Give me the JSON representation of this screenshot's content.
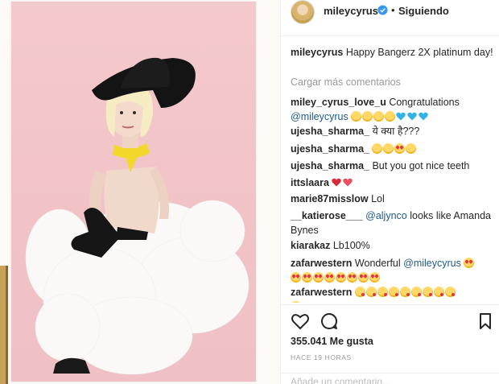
{
  "post": {
    "username": "mileycyrus",
    "follow_status": "Siguiendo",
    "dot": "•",
    "caption_user": "mileycyrus",
    "caption_text": "Happy Bangerz 2X platinum day!",
    "load_more": "Cargar más comentarios",
    "likes": "355.041 Me gusta",
    "time_ago": "HACE 19 HORAS",
    "add_comment_placeholder": "Añade un comentario..."
  },
  "comments": [
    {
      "user": "miley_cyrus_love_u",
      "text": "Congratulations",
      "mention": "@mileycyrus",
      "emoji": [
        "grin-icon",
        "grin-icon",
        "grin-icon",
        "grin-icon",
        "blue-heart-icon",
        "blue-heart-icon",
        "blue-heart-icon"
      ]
    },
    {
      "user": "ujesha_sharma_",
      "text": "ये क्या है???"
    },
    {
      "user": "ujesha_sharma_",
      "text": "",
      "emoji": [
        "laughing-icon",
        "grimace-icon",
        "star-eyes-icon",
        "smirk-icon"
      ]
    },
    {
      "user": "ujesha_sharma_",
      "text": "But you got nice teeth"
    },
    {
      "user": "ittslaara",
      "text": "",
      "emoji": [
        "heart-icon",
        "heart-icon"
      ]
    },
    {
      "user": "marie87misslow",
      "text": "Lol"
    },
    {
      "user": "__katierose___",
      "mention": "@aljynco",
      "text": "looks like Amanda Bynes"
    },
    {
      "user": "kiarakaz",
      "text": "Lb100%"
    },
    {
      "user": "zafarwestern",
      "text": "Wonderful",
      "mention": "@mileycyrus"
    },
    {
      "user": "zafarwestern",
      "text": ""
    }
  ],
  "icons": [
    "heart-outline-icon",
    "comment-icon",
    "bookmark-icon",
    "verified-badge-icon"
  ],
  "colors": {
    "accent": "#3897f0",
    "mention": "#1f5a8a",
    "muted": "#999999"
  }
}
